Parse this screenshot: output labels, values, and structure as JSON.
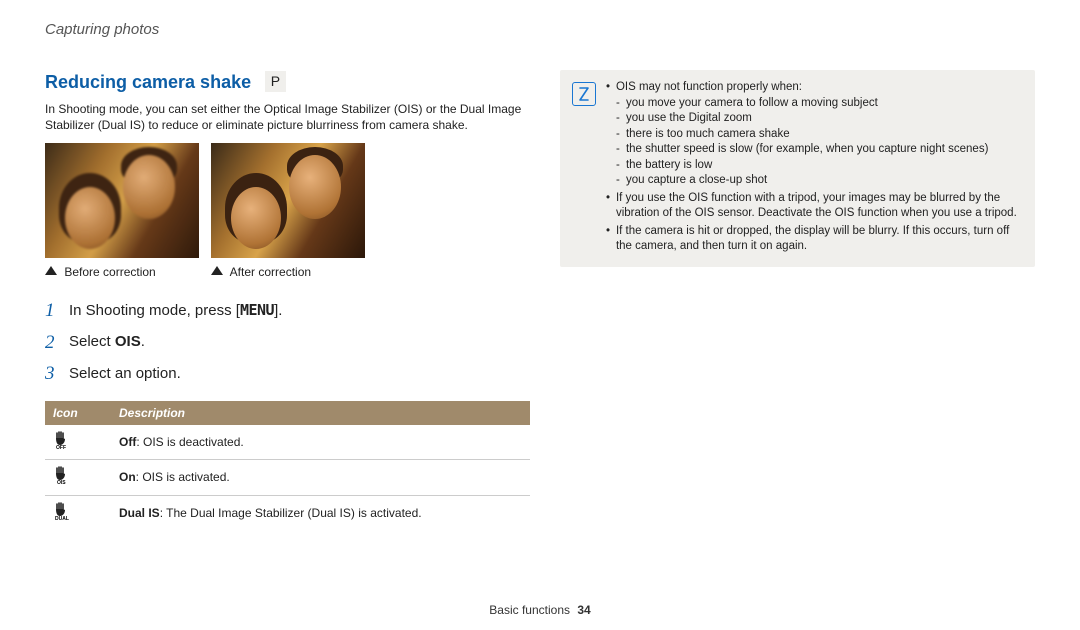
{
  "section": "Capturing photos",
  "title": "Reducing camera shake",
  "mode_badge": "P",
  "intro": "In Shooting mode, you can set either the Optical Image Stabilizer (OIS) or the Dual Image Stabilizer (Dual IS) to reduce or eliminate picture blurriness from camera shake.",
  "captions": {
    "before": "Before correction",
    "after": "After correction"
  },
  "steps": [
    {
      "num": "1",
      "prefix": "In Shooting mode, press [",
      "button": "MENU",
      "suffix": "]."
    },
    {
      "num": "2",
      "prefix": "Select ",
      "bold": "OIS",
      "suffix": "."
    },
    {
      "num": "3",
      "prefix": "Select an option.",
      "bold": "",
      "suffix": ""
    }
  ],
  "table": {
    "headers": {
      "icon": "Icon",
      "desc": "Description"
    },
    "rows": [
      {
        "icon_sub": "OFF",
        "label": "Off",
        "text": ": OIS is deactivated."
      },
      {
        "icon_sub": "OIS",
        "label": "On",
        "text": ": OIS is activated."
      },
      {
        "icon_sub": "DUAL",
        "label": "Dual IS",
        "text": ": The Dual Image Stabilizer (Dual IS) is activated."
      }
    ]
  },
  "note": {
    "b1_head": "OIS may not function properly when:",
    "b1_items": [
      "you move your camera to follow a moving subject",
      "you use the Digital zoom",
      "there is too much camera shake",
      "the shutter speed is slow (for example, when you capture night scenes)",
      "the battery is low",
      "you capture a close-up shot"
    ],
    "b2": "If you use the OIS function with a tripod, your images may be blurred by the vibration of the OIS sensor. Deactivate the OIS function when you use a tripod.",
    "b3": "If the camera is hit or dropped, the display will be blurry. If this occurs, turn off the camera, and then turn it on again."
  },
  "footer": {
    "label": "Basic functions",
    "page": "34"
  }
}
